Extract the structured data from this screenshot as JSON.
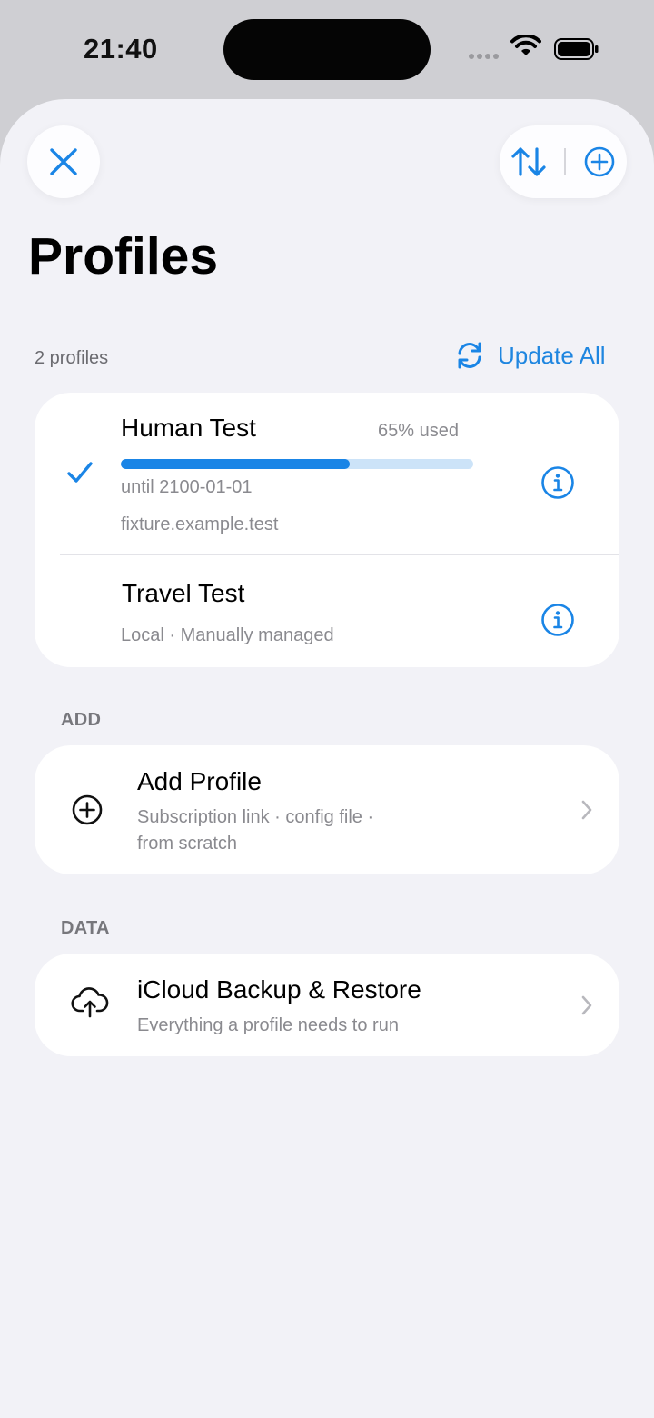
{
  "status_bar": {
    "time": "21:40"
  },
  "header": {
    "title": "Profiles",
    "close_icon": "close-x-icon",
    "sort_icon": "sort-arrows-icon",
    "add_icon": "plus-circle-icon"
  },
  "profiles_section": {
    "count_label": "2 profiles",
    "update_all_label": "Update All",
    "profiles": [
      {
        "name": "Human Test",
        "selected": true,
        "usage_label": "65% used",
        "usage_fraction": 0.65,
        "expiry": "until 2100-01-01",
        "host": "fixture.example.test"
      },
      {
        "name": "Travel Test",
        "selected": false,
        "subtitle": "Local · Manually managed"
      }
    ]
  },
  "add_section": {
    "label": "ADD",
    "item": {
      "title": "Add Profile",
      "subtitle_line1": "Subscription link · config file ·",
      "subtitle_line2": "from scratch"
    }
  },
  "data_section": {
    "label": "DATA",
    "item": {
      "title": "iCloud Backup & Restore",
      "subtitle": "Everything a profile needs to run"
    }
  },
  "colors": {
    "accent": "#1a85e6",
    "background": "#f2f2f7",
    "card": "#ffffff",
    "secondary_text": "#8a8a8f"
  }
}
